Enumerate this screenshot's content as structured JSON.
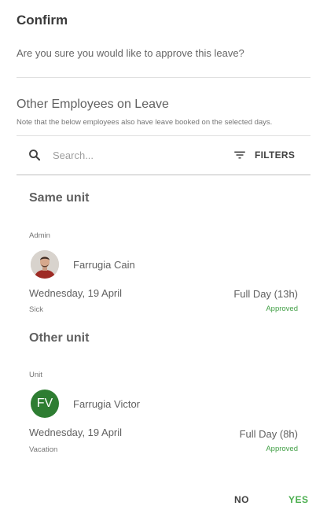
{
  "dialog": {
    "title": "Confirm",
    "question": "Are you sure you would like to approve this leave?",
    "section_title": "Other Employees on Leave",
    "note": "Note that the below employees also have leave booked on the selected days."
  },
  "search": {
    "placeholder": "Search...",
    "value": "",
    "filters_label": "FILTERS"
  },
  "groups": [
    {
      "title": "Same unit",
      "role": "Admin",
      "employee": {
        "name": "Farrugia Cain",
        "avatar_type": "photo",
        "date": "Wednesday, 19 April",
        "leave_type": "Sick",
        "duration": "Full Day (13h)",
        "status": "Approved"
      }
    },
    {
      "title": "Other unit",
      "role": "Unit",
      "employee": {
        "name": "Farrugia Victor",
        "avatar_type": "initials",
        "initials": "FV",
        "date": "Wednesday, 19 April",
        "leave_type": "Vacation",
        "duration": "Full Day (8h)",
        "status": "Approved"
      }
    }
  ],
  "actions": {
    "no_label": "NO",
    "yes_label": "YES"
  },
  "colors": {
    "accent_green": "#4caf50",
    "avatar_green": "#2e7d32",
    "status_green": "#43a047"
  }
}
